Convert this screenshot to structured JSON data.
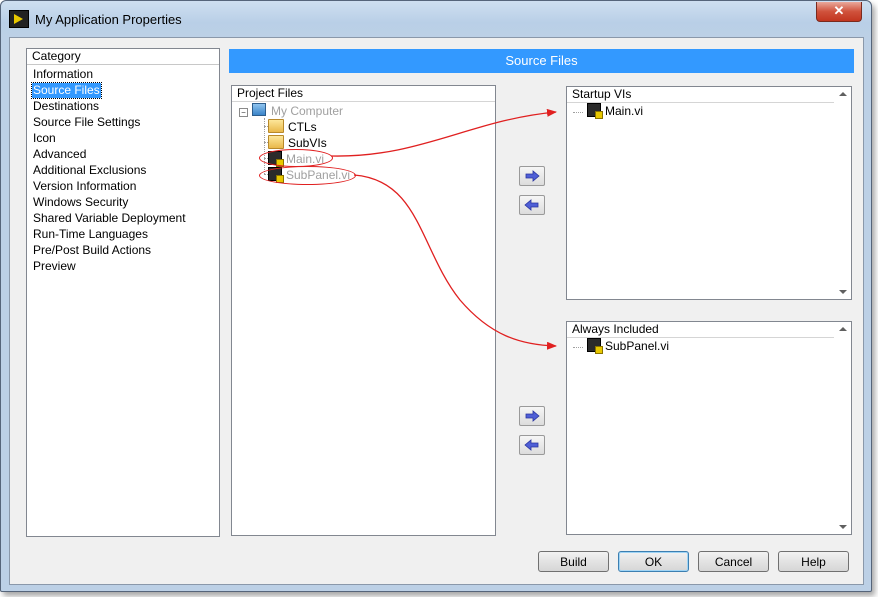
{
  "window": {
    "title": "My Application Properties",
    "close_glyph": "✕"
  },
  "category": {
    "header": "Category",
    "items": [
      "Information",
      "Source Files",
      "Destinations",
      "Source File Settings",
      "Icon",
      "Advanced",
      "Additional Exclusions",
      "Version Information",
      "Windows Security",
      "Shared Variable Deployment",
      "Run-Time Languages",
      "Pre/Post Build Actions",
      "Preview"
    ],
    "selected_index": 1
  },
  "banner": {
    "title": "Source Files"
  },
  "project_files": {
    "header": "Project Files",
    "root": "My Computer",
    "items": [
      "CTLs",
      "SubVIs",
      "Main.vi",
      "SubPanel.vi"
    ]
  },
  "startup_vis": {
    "header": "Startup VIs",
    "items": [
      "Main.vi"
    ]
  },
  "always_included": {
    "header": "Always Included",
    "items": [
      "SubPanel.vi"
    ]
  },
  "transfer": {
    "add_glyph": "⇨",
    "remove_glyph": "⇦"
  },
  "buttons": {
    "build": "Build",
    "ok": "OK",
    "cancel": "Cancel",
    "help": "Help"
  },
  "colors": {
    "selection": "#3399ff",
    "annotation": "#e02020",
    "arrow_icon": "#4f5fd6"
  }
}
